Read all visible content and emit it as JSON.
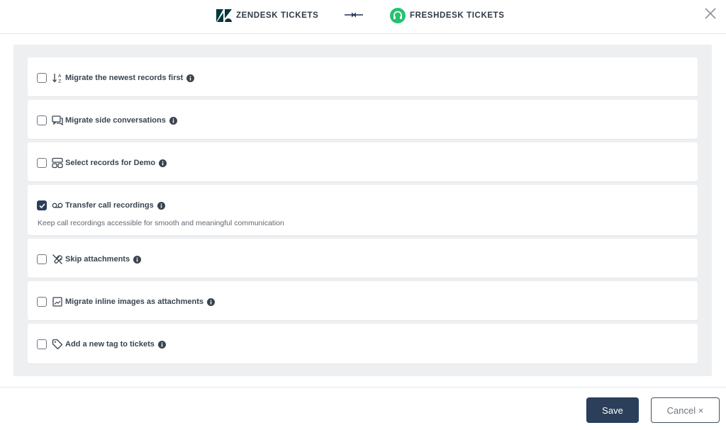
{
  "header": {
    "source_label": "ZENDESK TICKETS",
    "target_label": "FRESHDESK TICKETS"
  },
  "colors": {
    "accent": "#2b3e5a",
    "freshdesk_green": "#25c16f",
    "zendesk_dark": "#03363d"
  },
  "options": [
    {
      "label": "Migrate the newest records first",
      "icon": "sort-icon",
      "checked": false,
      "description": ""
    },
    {
      "label": "Migrate side conversations",
      "icon": "chat-icon",
      "checked": false,
      "description": ""
    },
    {
      "label": "Select records for Demo",
      "icon": "records-icon",
      "checked": false,
      "description": ""
    },
    {
      "label": "Transfer call recordings",
      "icon": "voicemail-icon",
      "checked": true,
      "description": "Keep call recordings accessible for smooth and meaningful communication"
    },
    {
      "label": "Skip attachments",
      "icon": "attachment-off-icon",
      "checked": false,
      "description": ""
    },
    {
      "label": "Migrate inline images as attachments",
      "icon": "image-icon",
      "checked": false,
      "description": ""
    },
    {
      "label": "Add a new tag to tickets",
      "icon": "tag-icon",
      "checked": false,
      "description": ""
    }
  ],
  "footer": {
    "save_label": "Save",
    "cancel_label": "Cancel ×"
  }
}
